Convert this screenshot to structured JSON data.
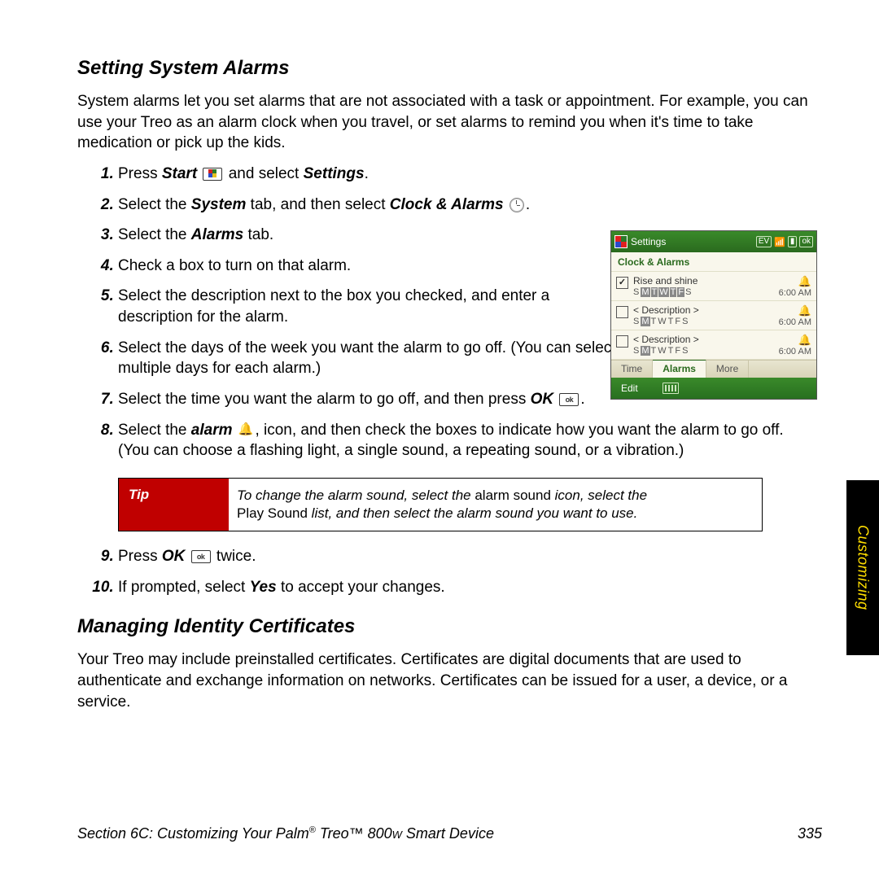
{
  "heading1": "Setting System Alarms",
  "intro1": "System alarms let you set alarms that are not associated with a task or appointment. For example, you can use your Treo as an alarm clock when you travel, or set alarms to remind you when it's time to take medication or pick up the kids.",
  "steps_a": {
    "s1a": "Press ",
    "s1b": "Start",
    "s1c": " and select ",
    "s1d": "Settings",
    "s1e": ".",
    "s2a": "Select the ",
    "s2b": "System",
    "s2c": " tab, and then select ",
    "s2d": "Clock & Alarms",
    "s2e": " .",
    "s3a": "Select the ",
    "s3b": "Alarms",
    "s3c": " tab.",
    "s4": "Check a box to turn on that alarm.",
    "s5": "Select the description next to the box you checked, and enter a description for the alarm.",
    "s6": "Select the days of the week you want the alarm to go off. (You can select multiple days for each alarm.)",
    "s7a": "Select the time you want the alarm to go off, and then press ",
    "s7b": "OK",
    "s7c": ".",
    "s8a": "Select the ",
    "s8b": "alarm",
    "s8c": ", icon, and then check the boxes to indicate how you want the alarm to go off. (You can choose a flashing light, a single sound, a repeating sound, or a vibration.)",
    "s9a": "Press ",
    "s9b": "OK",
    "s9c": " twice.",
    "s10a": "If prompted, select ",
    "s10b": "Yes",
    "s10c": " to accept your changes."
  },
  "tip": {
    "label": "Tip",
    "t1": "To change the alarm sound, select the ",
    "t2": "alarm sound",
    "t3": " icon, select the ",
    "t4": "Play Sound",
    "t5": " list, and then select the alarm sound you want to use."
  },
  "heading2": "Managing Identity Certificates",
  "intro2": "Your Treo may include preinstalled certificates. Certificates are digital documents that are used to authenticate and exchange information on networks. Certificates can be issued for a user, a device, or a service.",
  "side_tab": "Customizing",
  "footer_left_a": "Section 6C: Customizing Your Palm",
  "footer_left_b": "®",
  "footer_left_c": " Treo™ 800",
  "footer_left_d": "W",
  "footer_left_e": " Smart Device",
  "page_num": "335",
  "screenshot": {
    "title": "Settings",
    "status_ev": "EV",
    "status_ok": "ok",
    "subtitle": "Clock & Alarms",
    "alarms": [
      {
        "checked": true,
        "desc": "Rise and shine",
        "days": "SMTWTFS",
        "sel": [
          1,
          2,
          3,
          4,
          5
        ],
        "time": "6:00 AM"
      },
      {
        "checked": false,
        "desc": "< Description >",
        "days": "SMTWTFS",
        "sel": [
          1
        ],
        "time": "6:00 AM"
      },
      {
        "checked": false,
        "desc": "< Description >",
        "days": "SMTWTFS",
        "sel": [
          1
        ],
        "time": "6:00 AM"
      }
    ],
    "tabs": [
      "Time",
      "Alarms",
      "More"
    ],
    "active_tab": 1,
    "menu": "Edit"
  }
}
